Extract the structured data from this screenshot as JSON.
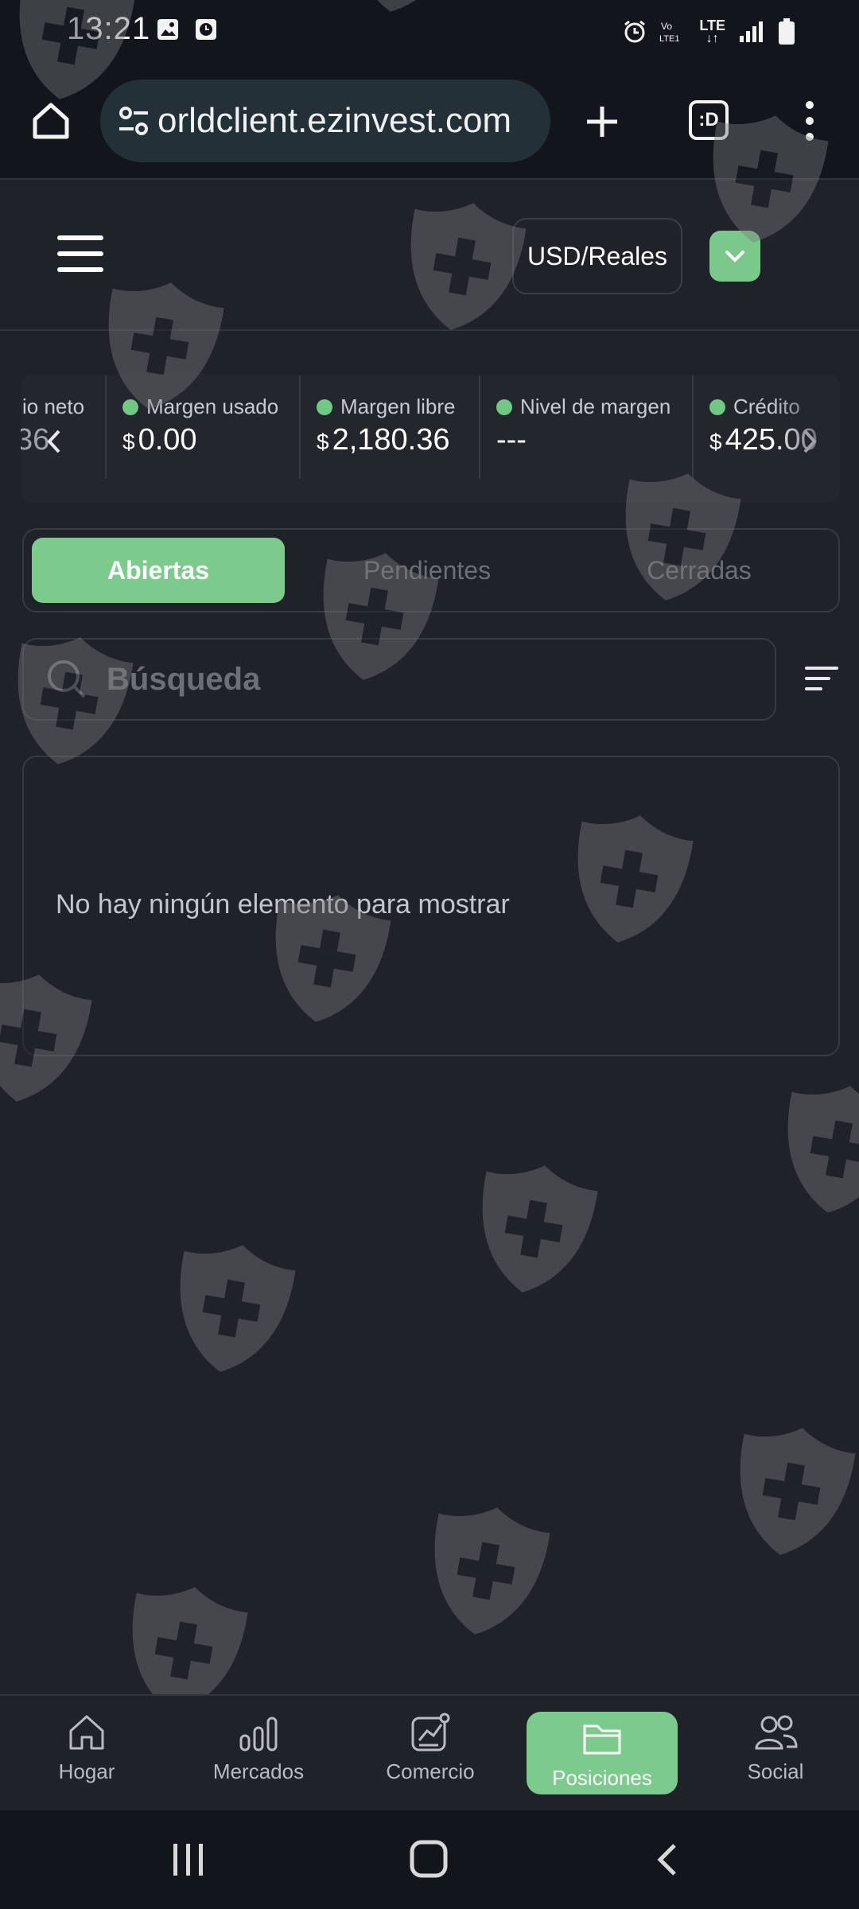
{
  "status_bar": {
    "time": "13:21",
    "network_label": "LTE"
  },
  "browser": {
    "url": "orldclient.ezinvest.com",
    "tab_button_label": ":D"
  },
  "header": {
    "account_label": "USD/Reales"
  },
  "stats": {
    "partial_left": {
      "label": "io neto",
      "value": "36"
    },
    "items": [
      {
        "label": "Margen usado",
        "currency": "$",
        "value": "0.00"
      },
      {
        "label": "Margen libre",
        "currency": "$",
        "value": "2,180.36"
      },
      {
        "label": "Nivel de margen",
        "currency": "",
        "value": "---"
      },
      {
        "label": "Crédito",
        "currency": "$",
        "value": "425.00"
      }
    ]
  },
  "tabs": [
    {
      "label": "Abiertas",
      "active": true
    },
    {
      "label": "Pendientes",
      "active": false
    },
    {
      "label": "Cerradas",
      "active": false
    }
  ],
  "search": {
    "placeholder": "Búsqueda"
  },
  "empty_state": {
    "message": "No hay ningún elemento para mostrar"
  },
  "bottom_nav": [
    {
      "label": "Hogar",
      "icon": "home-icon",
      "active": false
    },
    {
      "label": "Mercados",
      "icon": "markets-icon",
      "active": false
    },
    {
      "label": "Comercio",
      "icon": "trade-icon",
      "active": false
    },
    {
      "label": "Posiciones",
      "icon": "folder-icon",
      "active": true
    },
    {
      "label": "Social",
      "icon": "people-icon",
      "active": false
    }
  ],
  "colors": {
    "accent": "#7ccb8d",
    "background": "#1f2229",
    "bar": "#12161c"
  }
}
